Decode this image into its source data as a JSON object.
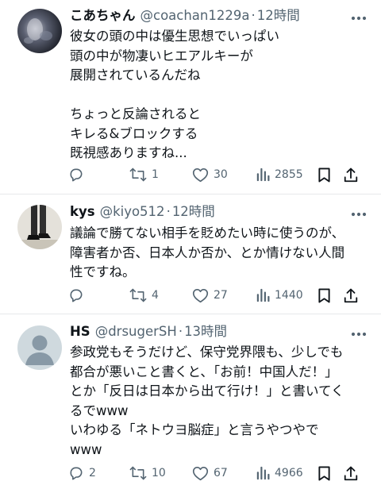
{
  "tweets": [
    {
      "name": "こあちゃん",
      "handle": "@coachan1229a",
      "sep": "·",
      "time": "12時間",
      "lines": [
        "彼女の頭の中は優生思想でいっぱい",
        "頭の中が物凄いヒエアルキーが",
        "展開されているんだね",
        "",
        "ちょっと反論されると",
        "キレる&ブロックする",
        "既視感ありますね..."
      ],
      "replies": "",
      "retweets": "1",
      "likes": "30",
      "views": "2855",
      "avatar": "blurred-photo"
    },
    {
      "name": "kys",
      "handle": "@kiyo512",
      "sep": "·",
      "time": "12時間",
      "lines": [
        "議論で勝てない相手を貶めたい時に使うのが、",
        "障害者か否、日本人か否か、とか情けない人間",
        "性ですね。"
      ],
      "replies": "",
      "retweets": "4",
      "likes": "27",
      "views": "1440",
      "avatar": "legs-photo"
    },
    {
      "name": "HS",
      "handle": "@drsugerSH",
      "sep": "·",
      "time": "13時間",
      "lines": [
        "参政党もそうだけど、保守党界隈も、少しでも",
        "都合が悪いこと書くと、「お前！中国人だ！」",
        "とか「反日は日本から出て行け！」と書いてく",
        "るでwww",
        "いわゆる「ネトウヨ脳症」と言うやつやで",
        "www"
      ],
      "replies": "2",
      "retweets": "10",
      "likes": "67",
      "views": "4966",
      "avatar": "default-avatar"
    }
  ],
  "icons": {
    "reply": "reply-icon",
    "retweet": "retweet-icon",
    "like": "heart-icon",
    "views": "views-bar-icon",
    "bookmark": "bookmark-icon",
    "share": "share-icon",
    "more": "more-dots-icon"
  },
  "colors": {
    "text": "#0f1419",
    "secondary": "#536471",
    "divider": "#e7e9ea"
  }
}
